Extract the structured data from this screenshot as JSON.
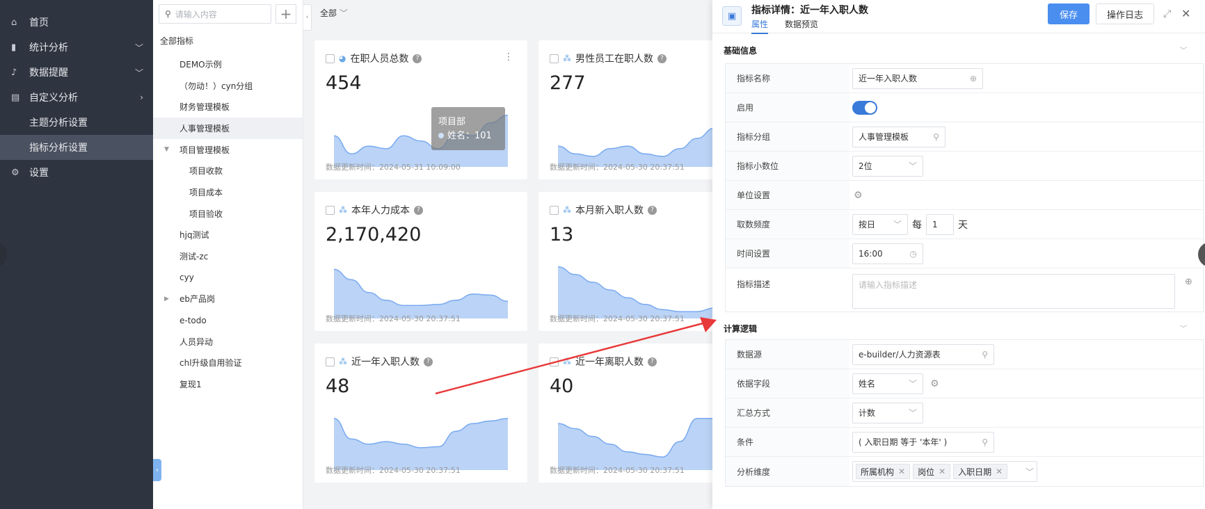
{
  "nav": {
    "items": [
      {
        "label": "首页",
        "icon": "home-icon"
      },
      {
        "label": "统计分析",
        "icon": "bar-chart-icon",
        "chevron": "down"
      },
      {
        "label": "数据提醒",
        "icon": "bell-icon",
        "chevron": "down"
      },
      {
        "label": "自定义分析",
        "icon": "custom-analysis-icon",
        "chevron": "right"
      }
    ],
    "sub_items": [
      "主题分析设置",
      "指标分析设置"
    ],
    "settings": "设置"
  },
  "tree": {
    "search_placeholder": "请输入内容",
    "all_label": "全部指标",
    "items": [
      "DEMO示例",
      "（勿动！）cyn分组",
      "财务管理模板",
      "人事管理模板",
      "项目管理模板"
    ],
    "sub_items": [
      "项目收款",
      "项目成本",
      "项目验收"
    ],
    "items2": [
      "hjq测试",
      "测试-zc",
      "cyy",
      "eb产品岗",
      "e-todo",
      "人员异动",
      "chl升级自用验证",
      "复现1"
    ]
  },
  "main": {
    "filter_label": "全部",
    "cards": [
      {
        "title": "在职人员总数",
        "value": "454",
        "time": "数据更新时间：2024-05-31 10:09:00",
        "points": [
          0.55,
          0.2,
          0.35,
          0.3,
          0.55,
          0.45,
          0.3,
          0.6,
          0.55,
          0.8,
          0.95
        ]
      },
      {
        "title": "男性员工在职人数",
        "value": "277",
        "time": "数据更新时间：2024-05-30 20:37:51",
        "points": [
          0.35,
          0.2,
          0.15,
          0.3,
          0.35,
          0.2,
          0.15,
          0.3,
          0.5,
          0.7,
          0.9
        ]
      },
      {
        "title": "本年人力成本",
        "value": "2,170,420",
        "time": "数据更新时间：2024-05-30 20:37:51",
        "points": [
          0.9,
          0.7,
          0.45,
          0.3,
          0.2,
          0.2,
          0.22,
          0.3,
          0.42,
          0.4,
          0.28
        ]
      },
      {
        "title": "本月新入职人数",
        "value": "13",
        "time": "数据更新时间：2024-05-30 20:37:51",
        "points": [
          0.95,
          0.8,
          0.65,
          0.5,
          0.35,
          0.22,
          0.12,
          0.08,
          0.08,
          0.15,
          0.3
        ]
      },
      {
        "title": "近一年入职人数",
        "value": "48",
        "time": "数据更新时间：2024-05-30 20:37:51",
        "points": [
          0.95,
          0.55,
          0.45,
          0.5,
          0.45,
          0.38,
          0.4,
          0.7,
          0.85,
          0.9,
          0.95
        ]
      },
      {
        "title": "近一年离职人数",
        "value": "40",
        "time": "数据更新时间：2024-05-30 20:37:51",
        "points": [
          0.85,
          0.75,
          0.6,
          0.45,
          0.3,
          0.25,
          0.2,
          0.5,
          0.95,
          0.95,
          0.9
        ]
      }
    ],
    "tooltip": {
      "title": "项目部",
      "line": "姓名：101"
    }
  },
  "drawer": {
    "title": "指标详情：近一年入职人数",
    "tabs": [
      "属性",
      "数据预览"
    ],
    "save": "保存",
    "log": "操作日志",
    "basic_title": "基础信息",
    "basic": {
      "name_label": "指标名称",
      "name_value": "近一年入职人数",
      "enable_label": "启用",
      "group_label": "指标分组",
      "group_value": "人事管理模板",
      "decimal_label": "指标小数位",
      "decimal_value": "2位",
      "unit_label": "单位设置",
      "freq_label": "取数频度",
      "freq_value": "按日",
      "freq_every": "每",
      "freq_num": "1",
      "freq_day": "天",
      "time_label": "时间设置",
      "time_value": "16:00",
      "desc_label": "指标描述",
      "desc_placeholder": "请输入指标描述"
    },
    "calc_title": "计算逻辑",
    "calc": {
      "source_label": "数据源",
      "source_value": "e-builder/人力资源表",
      "field_label": "依据字段",
      "field_value": "姓名",
      "agg_label": "汇总方式",
      "agg_value": "计数",
      "cond_label": "条件",
      "cond_value": "( 入职日期 等于 '本年' )",
      "dim_label": "分析维度",
      "dims": [
        "所属机构",
        "岗位",
        "入职日期"
      ]
    }
  }
}
